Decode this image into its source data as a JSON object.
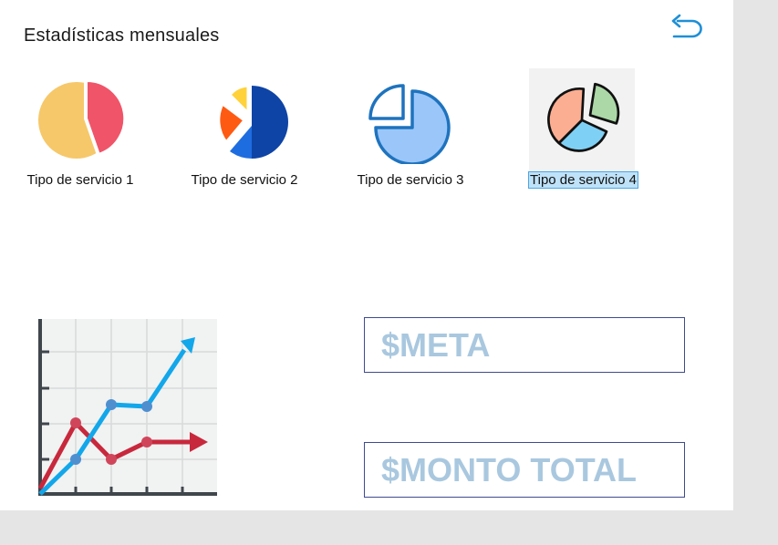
{
  "header": {
    "title": "Estadísticas mensuales"
  },
  "tiles": [
    {
      "label": "Tipo de servicio 1"
    },
    {
      "label": "Tipo de servicio 2"
    },
    {
      "label": "Tipo de servicio 3"
    },
    {
      "label": "Tipo de servicio 4"
    }
  ],
  "fields": {
    "meta_placeholder": "$META",
    "monto_placeholder": "$MONTO TOTAL"
  },
  "icons": {
    "back": "back-arrow-icon",
    "pie1": "pie-chart-icon",
    "pie2": "pie-chart-icon",
    "pie3": "pie-chart-icon",
    "pie4": "pie-chart-icon",
    "growth": "line-chart-icon"
  },
  "colors": {
    "accent": "#1f8fd6",
    "field_border": "#3f4a8f",
    "placeholder": "#a9c8df"
  }
}
